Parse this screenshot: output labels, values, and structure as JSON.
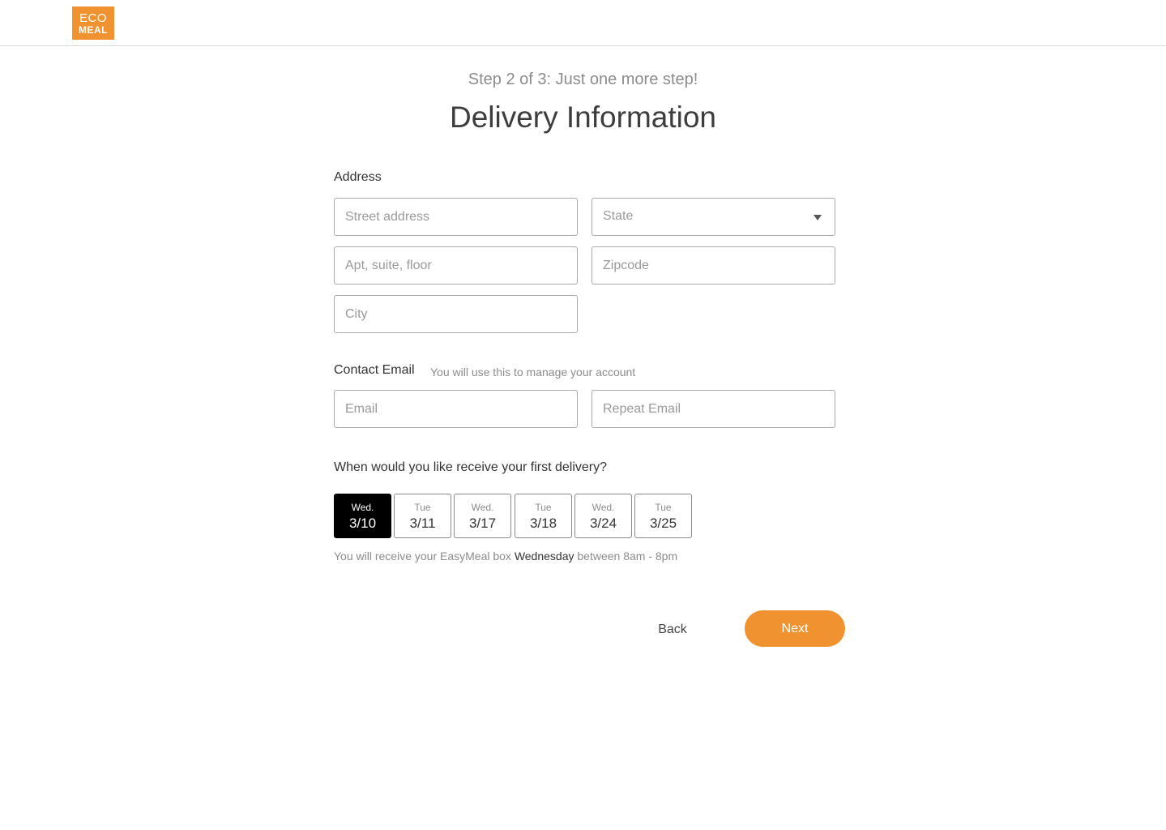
{
  "header": {
    "logo_line1": "ECO",
    "logo_line2": "MEAL"
  },
  "page": {
    "step_text": "Step 2 of 3: Just one more step!",
    "title": "Delivery Information"
  },
  "address": {
    "label": "Address",
    "street_placeholder": "Street address",
    "apt_placeholder": "Apt, suite, floor",
    "city_placeholder": "City",
    "state_value": "State",
    "zip_placeholder": "Zipcode"
  },
  "contact": {
    "label": "Contact Email",
    "hint": "You will use this to manage your account",
    "email_placeholder": "Email",
    "repeat_placeholder": "Repeat Email"
  },
  "delivery": {
    "question": "When would you like receive your first delivery?",
    "dates": [
      {
        "weekday": "Wed.",
        "date": "3/10",
        "selected": true
      },
      {
        "weekday": "Tue",
        "date": "3/11",
        "selected": false
      },
      {
        "weekday": "Wed.",
        "date": "3/17",
        "selected": false
      },
      {
        "weekday": "Tue",
        "date": "3/18",
        "selected": false
      },
      {
        "weekday": "Wed.",
        "date": "3/24",
        "selected": false
      },
      {
        "weekday": "Tue",
        "date": "3/25",
        "selected": false
      }
    ],
    "note_prefix": "You will receive your EasyMeal box",
    "note_day": "Wednesday",
    "note_suffix": "between 8am - 8pm"
  },
  "actions": {
    "back_label": "Back",
    "next_label": "Next"
  },
  "colors": {
    "brand": "#f0922f",
    "selected_date": "#000000"
  }
}
